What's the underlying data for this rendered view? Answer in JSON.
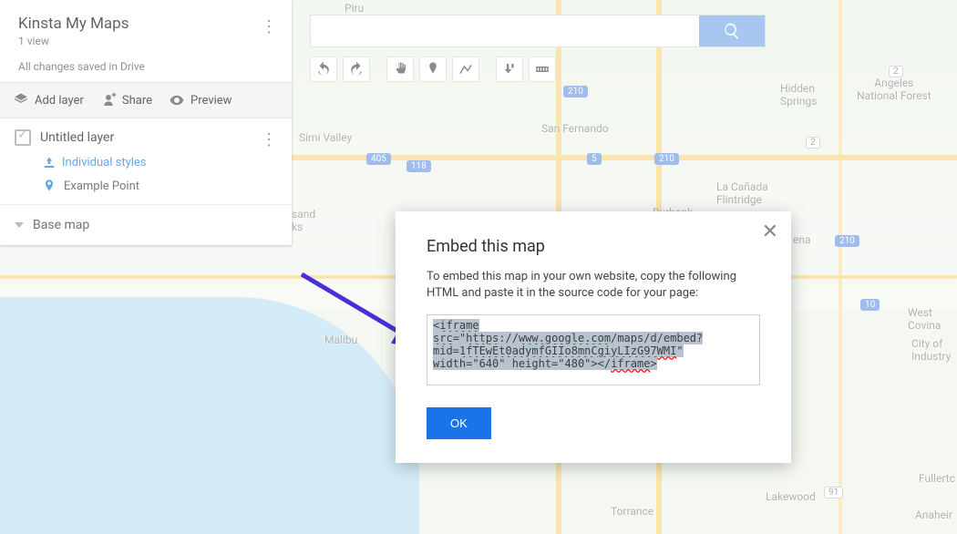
{
  "panel": {
    "title": "Kinsta My Maps",
    "views": "1 view",
    "saved": "All changes saved in Drive",
    "addLayer": "Add layer",
    "share": "Share",
    "preview": "Preview",
    "layerName": "Untitled layer",
    "stylesLabel": "Individual styles",
    "pointLabel": "Example Point",
    "baseMap": "Base map"
  },
  "search": {
    "placeholder": ""
  },
  "mapLabels": {
    "piru": "Piru",
    "angeles": "Angeles\nNational Forest",
    "hidden": "Hidden\nSprings",
    "sanfernando": "San Fernando",
    "simi": "Simi Valley",
    "lacanada": "La Cañada\nFlintridge",
    "burbank": "Burbank",
    "sand": "sand\nks",
    "ena": "ena",
    "malibu": "Malibu",
    "westcovina": "West Covina",
    "industry": "City of\nIndustry",
    "torrance": "Torrance",
    "lakewood": "Lakewood",
    "fullerton": "Fullertc",
    "anaheir": "Anaheir"
  },
  "modal": {
    "title": "Embed this map",
    "text": "To embed this map in your own website, copy the following HTML and paste it in the source code for your page:",
    "code": "<iframe src=\"https://www.google.com/maps/d/embed?mid=1fTEwEt0adymfGIIo8mnCgiyLIzG97WMI\" width=\"640\" height=\"480\"></iframe>",
    "ok": "OK"
  }
}
